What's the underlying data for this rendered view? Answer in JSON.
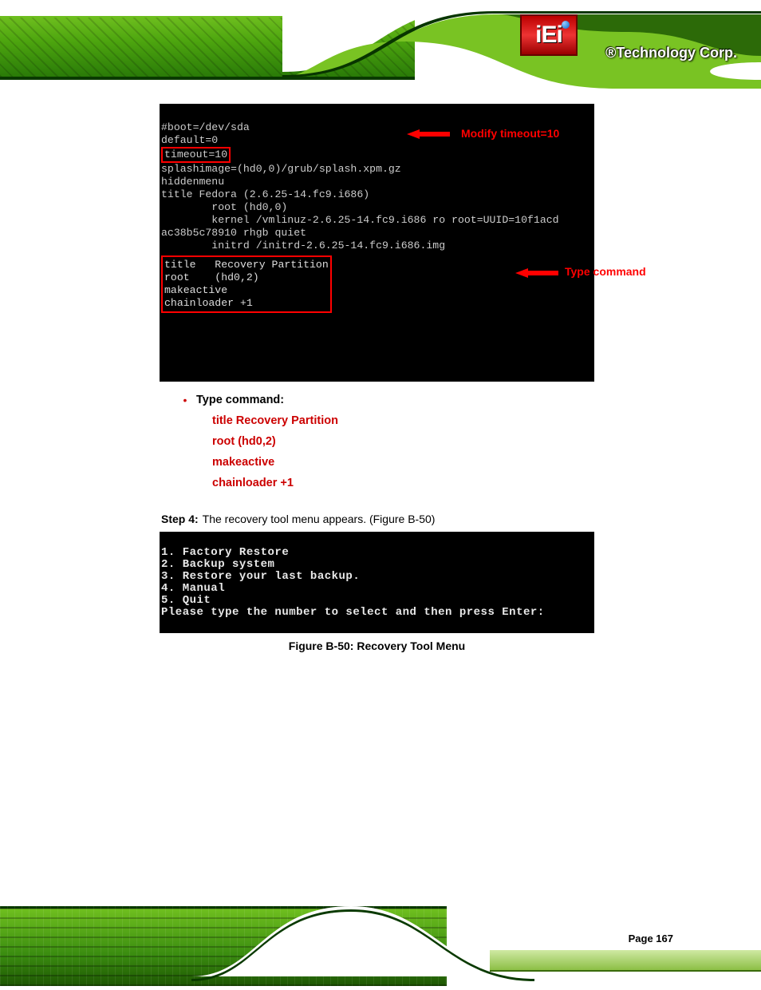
{
  "brand": {
    "logo_text": "iEi",
    "company": "®Technology Corp."
  },
  "terminal1_anno": {
    "arrow1_label": "Modify timeout=10",
    "arrow2_label": "Type command"
  },
  "terminal1": {
    "l1": "#boot=/dev/sda",
    "l2": "default=0",
    "l3_boxed": "timeout=10",
    "l4": "splashimage=(hd0,0)/grub/splash.xpm.gz",
    "l5": "hiddenmenu",
    "l6": "title Fedora (2.6.25-14.fc9.i686)",
    "l7": "        root (hd0,0)",
    "l8": "        kernel /vmlinuz-2.6.25-14.fc9.i686 ro root=UUID=10f1acd",
    "l9": "ac38b5c78910 rhgb quiet",
    "l10": "        initrd /initrd-2.6.25-14.fc9.i686.img",
    "block": {
      "b1": "title   Recovery Partition",
      "b2": "root    (hd0,2)",
      "b3": "makeactive",
      "b4": "chainloader +1"
    }
  },
  "bullet": {
    "label": "Type command:",
    "cmd1": "title Recovery Partition",
    "cmd2": "root (hd0,2)",
    "cmd3": "makeactive",
    "cmd4": "chainloader +1"
  },
  "step": {
    "prefix": "Step 4:",
    "text": "The recovery tool menu appears. (Figure B-50)"
  },
  "terminal2": {
    "m1": "1. Factory Restore",
    "m2": "2. Backup system",
    "m3": "3. Restore your last backup.",
    "m4": "4. Manual",
    "m5": "5. Quit",
    "prompt": "Please type the number to select and then press Enter:"
  },
  "caption": "Figure B-50: Recovery Tool Menu",
  "page": "Page 167"
}
